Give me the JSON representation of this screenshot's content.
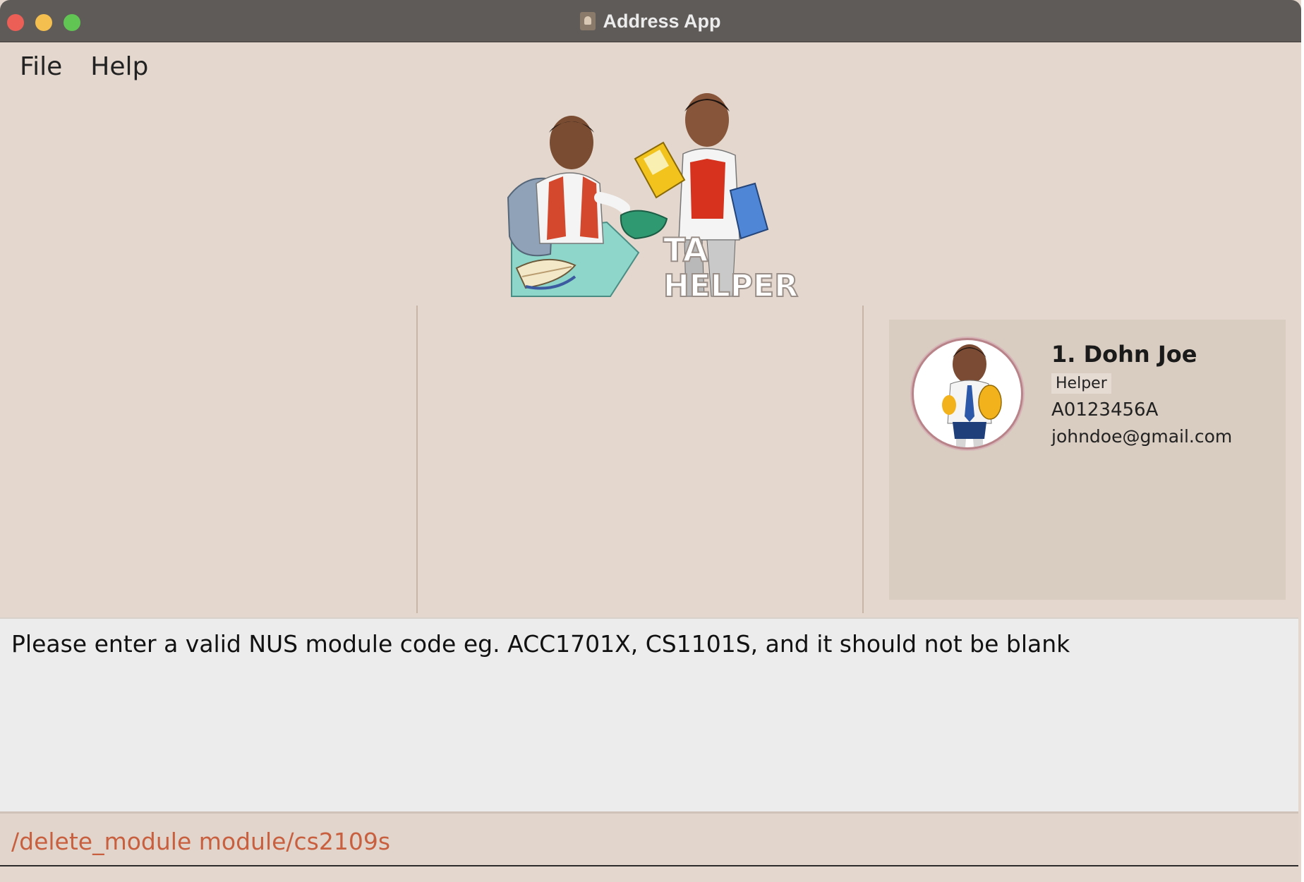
{
  "window": {
    "title": "Address App"
  },
  "menu": {
    "items": [
      "File",
      "Help"
    ]
  },
  "logo": {
    "text_line1": "TA",
    "text_line2": "HELPER"
  },
  "person_card": {
    "index_name": "1.  Dohn Joe",
    "role": "Helper",
    "student_id": "A0123456A",
    "email": "johndoe@gmail.com"
  },
  "result": {
    "message": "Please enter a valid NUS module code eg. ACC1701X, CS1101S, and it should not be blank"
  },
  "command": {
    "value": "/delete_module module/cs2109s"
  },
  "colors": {
    "background": "#e4d7ce",
    "titlebar": "#5f5b59",
    "command_text": "#c8603f",
    "card": "#d9ccc0"
  }
}
